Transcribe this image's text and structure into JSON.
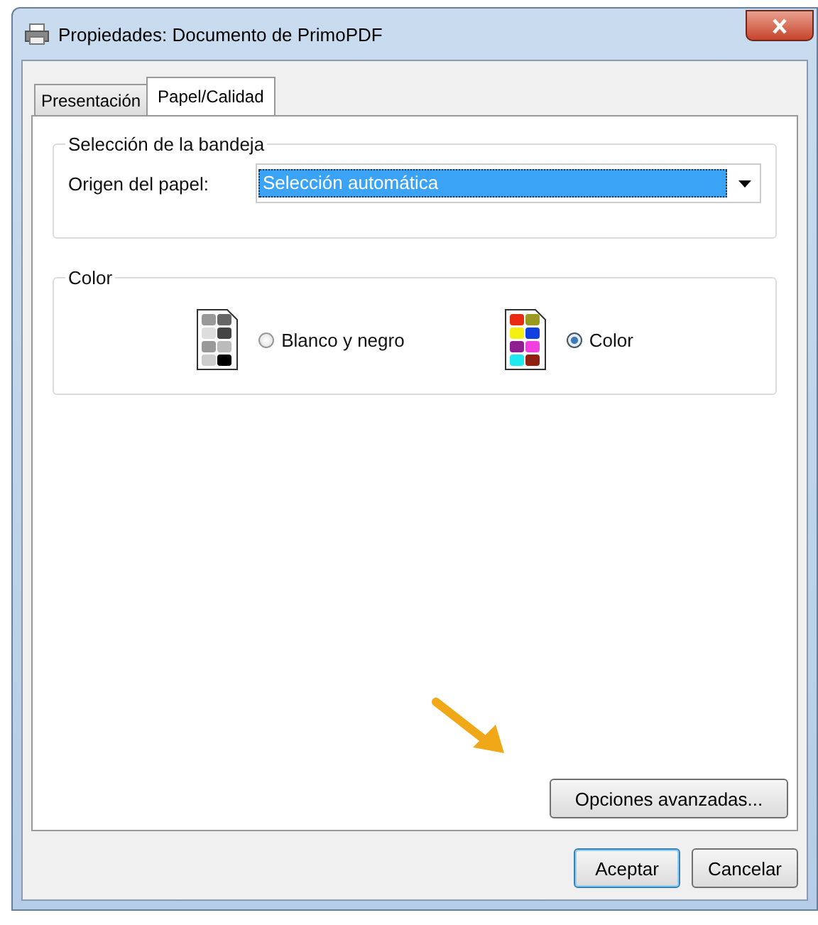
{
  "window": {
    "title": "Propiedades: Documento de PrimoPDF"
  },
  "tabs": [
    {
      "label": "Presentación",
      "selected": false
    },
    {
      "label": "Papel/Calidad",
      "selected": true
    }
  ],
  "tray_group": {
    "title": "Selección de la bandeja",
    "label": "Origen del papel:",
    "dropdown": {
      "value": "Selección automática"
    }
  },
  "color_group": {
    "title": "Color",
    "options": [
      {
        "label": "Blanco y negro",
        "kind": "mono",
        "selected": false
      },
      {
        "label": "Color",
        "kind": "color",
        "selected": true
      }
    ]
  },
  "advanced_button": "Opciones avanzadas...",
  "buttons": [
    {
      "label": "Aceptar",
      "kind": "default"
    },
    {
      "label": "Cancelar",
      "kind": "normal"
    }
  ]
}
